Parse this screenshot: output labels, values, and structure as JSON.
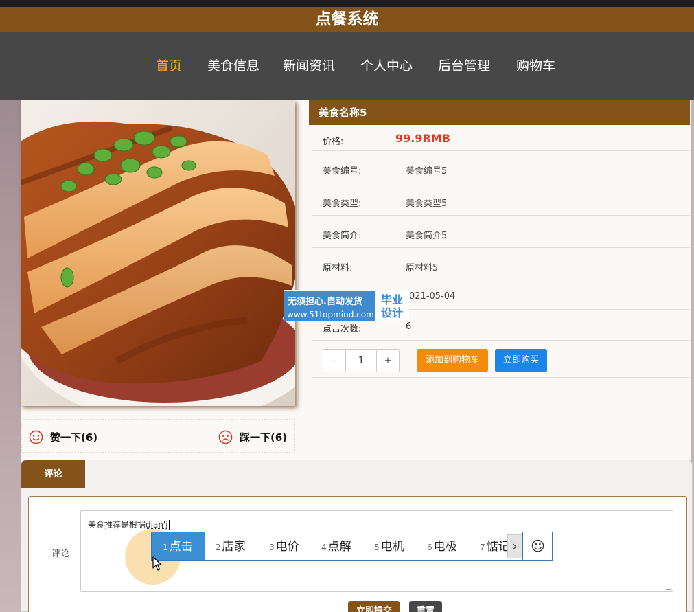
{
  "header": {
    "title": "点餐系统"
  },
  "nav": {
    "items": [
      {
        "label": "首页",
        "active": true
      },
      {
        "label": "美食信息"
      },
      {
        "label": "新闻资讯"
      },
      {
        "label": "个人中心"
      },
      {
        "label": "后台管理"
      },
      {
        "label": "购物车"
      }
    ]
  },
  "product": {
    "name": "美食名称5",
    "price_label": "价格:",
    "price": "99.9RMB",
    "fields": [
      {
        "label": "美食编号:",
        "value": "美食编号5"
      },
      {
        "label": "美食类型:",
        "value": "美食类型5"
      },
      {
        "label": "美食简介:",
        "value": "美食简介5"
      },
      {
        "label": "原材料:",
        "value": "原材料5"
      },
      {
        "label": "",
        "value": "021-05-04"
      },
      {
        "label": "点击次数:",
        "value": "6"
      }
    ],
    "quantity": {
      "minus": "-",
      "value": "1",
      "plus": "+"
    },
    "add_to_cart": "添加到购物车",
    "buy_now": "立即购买"
  },
  "votes": {
    "like": "赞一下(6)",
    "dislike": "踩一下(6)"
  },
  "watermark": {
    "line1": "无须担心.自动发货",
    "line2": "www.51topmind.com",
    "badge_top": "毕业",
    "badge_bottom": "设计"
  },
  "comments": {
    "tab": "评论",
    "label": "评论",
    "text_prefix": "美食推荐是根据",
    "text_typing": "dian'j",
    "submit": "立即提交",
    "reset": "重置"
  },
  "ime": {
    "candidates": [
      {
        "n": "1",
        "text": "点击"
      },
      {
        "n": "2",
        "text": "店家"
      },
      {
        "n": "3",
        "text": "电价"
      },
      {
        "n": "4",
        "text": "点解"
      },
      {
        "n": "5",
        "text": "电机"
      },
      {
        "n": "6",
        "text": "电极"
      },
      {
        "n": "7",
        "text": "惦记"
      }
    ],
    "next": "›",
    "emoji": "☺"
  },
  "colors": {
    "brand": "#84531a",
    "nav_bg": "#474747",
    "active": "#f5a81f",
    "price": "#e23a1e",
    "cart": "#f58b0c",
    "buy": "#1b86ea"
  }
}
